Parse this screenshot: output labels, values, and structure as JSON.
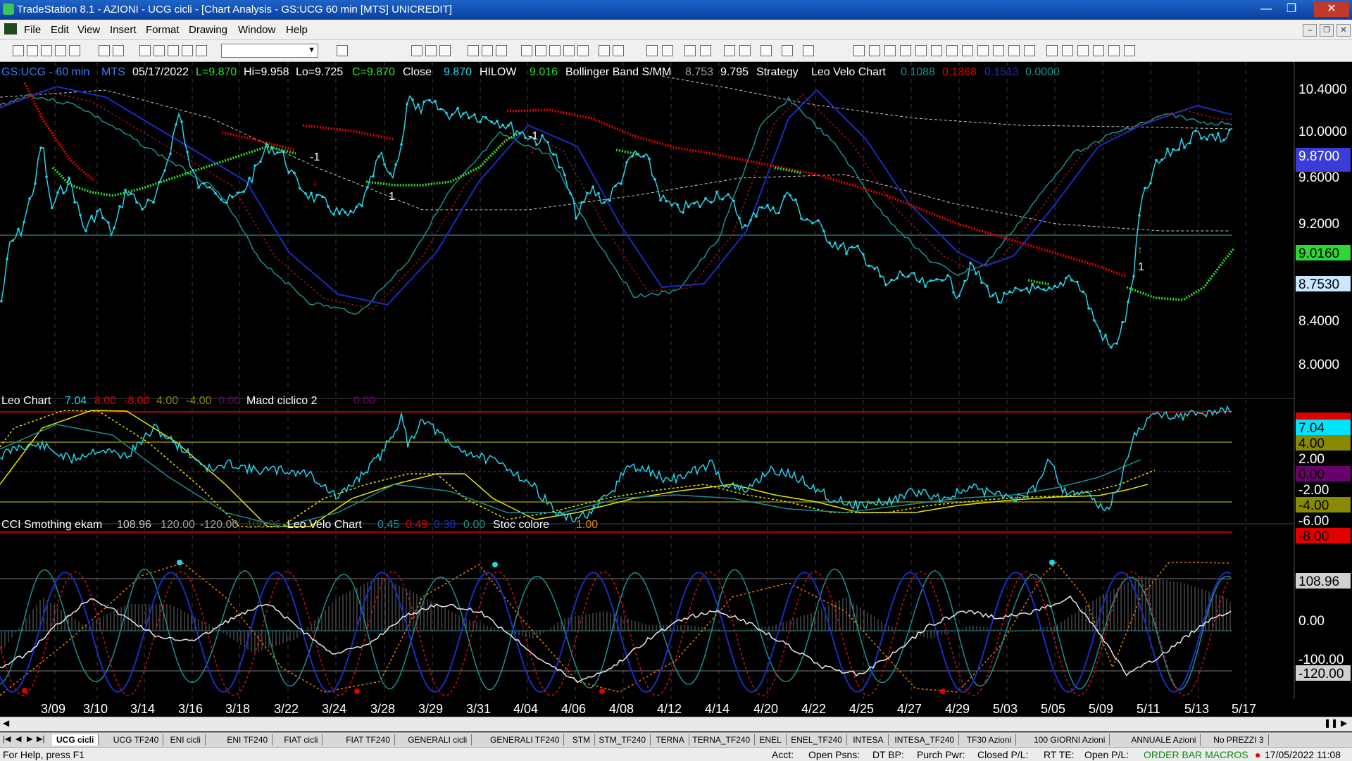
{
  "window": {
    "title": "TradeStation 8.1 - AZIONI - UCG cicli - [Chart Analysis - GS:UCG  60 min  [MTS] UNICREDIT]"
  },
  "menu": [
    "File",
    "Edit",
    "View",
    "Insert",
    "Format",
    "Drawing",
    "Window",
    "Help"
  ],
  "panel1": {
    "symbol": "GS:UCG - 60 min",
    "exchange": "MTS",
    "date": "05/17/2022",
    "low": "L=9.870",
    "high": "Hi=9.958",
    "lo": "Lo=9.725",
    "close": "C=9.870",
    "close_label": "Close",
    "close_value": "9.870",
    "hilow_label": "HILOW",
    "hilow_value": "9.016",
    "bb_label": "Bollinger Band S/MM",
    "bb_value1": "8.753",
    "bb_value2": "9.795",
    "strategy_label": "Strategy",
    "leo_label": "Leo Velo Chart",
    "leo_v1": "0.1088",
    "leo_v2": "0.1368",
    "leo_v3": "0.1513",
    "leo_v4": "0.0000",
    "axis_ticks": [
      "10.4000",
      "10.0000",
      "9.6000",
      "9.2000",
      "8.4000",
      "8.0000"
    ],
    "badges": [
      {
        "text": "9.8700",
        "color": "#3b3bd8"
      },
      {
        "text": "9.7950",
        "color": "#3b3bd8"
      },
      {
        "text": "9.0160",
        "color": "#2ed832"
      },
      {
        "text": "8.7530",
        "color": "#c9e8ff"
      }
    ],
    "markers": [
      "-1",
      "1",
      "-1",
      "1"
    ]
  },
  "panel2": {
    "title": "Leo Chart",
    "v1": "7.04",
    "v2": "8.00",
    "v3": "-8.00",
    "v4": "4.00",
    "v5": "-4.00",
    "v6": "0.00",
    "macd_label": "Macd ciclico 2",
    "macd_value": "0.00",
    "axis_ticks": [
      "2.00",
      "-2.00",
      "-6.00"
    ],
    "badges": [
      {
        "text": "7.04",
        "color": "#00e5ff"
      },
      {
        "text": "4.00",
        "color": "#8a8a00"
      },
      {
        "text": "0.00",
        "color": "#6a006a"
      },
      {
        "text": "-4.00",
        "color": "#8a8a00"
      },
      {
        "text": "-8.00",
        "color": "#e00000"
      }
    ]
  },
  "panel3": {
    "title": "CCI Smothing ekam",
    "v1": "108.96",
    "v2": "120.00",
    "v3": "-120.00",
    "v4": "108.96",
    "leo_label": "Leo Velo Chart",
    "l1": "0.45",
    "l2": "0.49",
    "l3": "0.38",
    "l4": "0.00",
    "stoc_label": "Stoc colore",
    "stoc_value": "1.00",
    "axis_ticks": [
      "0.00",
      "-100.00"
    ],
    "badges": [
      {
        "text": "108.96",
        "color": "#d0d0d0"
      },
      {
        "text": "-120.00",
        "color": "#d0d0d0"
      }
    ]
  },
  "dates": [
    "3/09",
    "3/10",
    "3/14",
    "3/16",
    "3/18",
    "3/22",
    "3/24",
    "3/28",
    "3/29",
    "3/31",
    "4/04",
    "4/06",
    "4/08",
    "4/12",
    "4/14",
    "4/20",
    "4/22",
    "4/25",
    "4/27",
    "4/29",
    "5/03",
    "5/05",
    "5/09",
    "5/11",
    "5/13",
    "5/17"
  ],
  "tabs": [
    "UCG cicli",
    "UCG TF240",
    "ENI cicli",
    "ENI TF240",
    "FIAT cicli",
    "FIAT TF240",
    "GENERALI cicli",
    "GENERALI TF240",
    "STM",
    "STM_TF240",
    "TERNA",
    "TERNA_TF240",
    "ENEL",
    "ENEL_TF240",
    "INTESA",
    "INTESA_TF240",
    "TF30 Azioni",
    "100 GIORNI Azioni",
    "ANNUALE Azioni",
    "No PREZZI 3"
  ],
  "status": {
    "help": "For Help, press F1",
    "acct": "Acct:",
    "open_psns": "Open Psns:",
    "dtbp": "DT BP:",
    "purch": "Purch Pwr:",
    "closed": "Closed P/L:",
    "rtte": "RT TE:",
    "openpl": "Open P/L:",
    "macros": "ORDER BAR  MACROS",
    "datetime": "17/05/2022 11:08"
  },
  "colors": {
    "price": "#23d4e8",
    "red_band": "#e00000",
    "green_band": "#29e329",
    "blue_wave": "#1b2cc0",
    "teal_wave": "#1d8f8f",
    "yellow": "#e6e600"
  }
}
